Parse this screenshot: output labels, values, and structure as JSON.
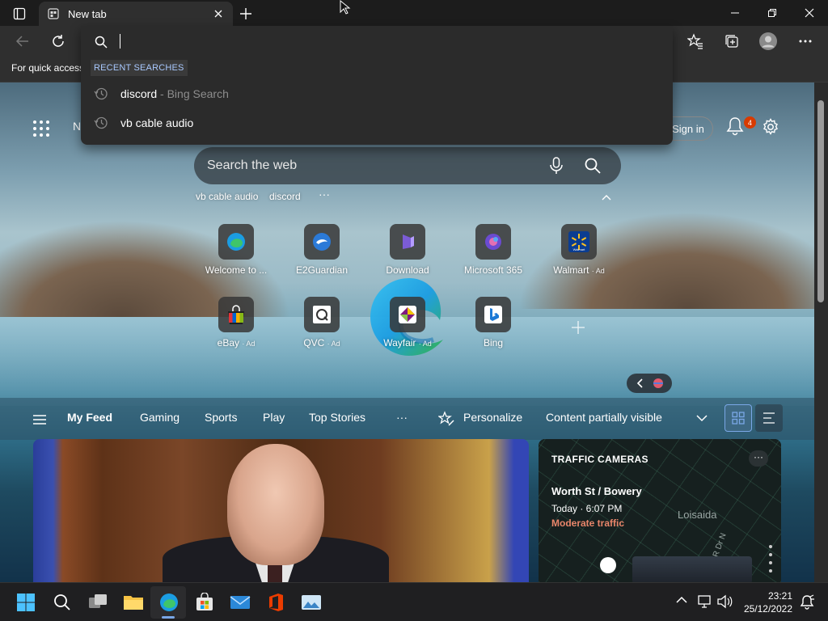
{
  "browser": {
    "tab_title": "New tab",
    "favorites_bar_text": "For quick access"
  },
  "omnibox": {
    "heading": "RECENT SEARCHES",
    "suggestions": [
      {
        "query": "discord",
        "suffix": " - Bing Search"
      },
      {
        "query": "vb cable audio",
        "suffix": ""
      }
    ]
  },
  "newtab": {
    "partial_header_letter": "N",
    "signin_label": "Sign in",
    "notification_count": "4",
    "search_placeholder": "Search the web",
    "recent_chips": [
      "vb cable audio",
      "discord"
    ],
    "more_chips": "···",
    "tiles": [
      {
        "label": "Welcome to ...",
        "ad": "",
        "icon": "edge-icon"
      },
      {
        "label": "E2Guardian",
        "ad": "",
        "icon": "e2guardian-icon"
      },
      {
        "label": "Download",
        "ad": "",
        "icon": "download-icon"
      },
      {
        "label": "Microsoft 365",
        "ad": "",
        "icon": "microsoft-365-icon"
      },
      {
        "label": "Walmart",
        "ad": "· Ad",
        "icon": "walmart-icon"
      },
      {
        "label": "eBay",
        "ad": "· Ad",
        "icon": "ebay-icon"
      },
      {
        "label": "QVC",
        "ad": "· Ad",
        "icon": "qvc-icon"
      },
      {
        "label": "Wayfair",
        "ad": "· Ad",
        "icon": "wayfair-icon"
      },
      {
        "label": "Bing",
        "ad": "",
        "icon": "bing-icon"
      }
    ],
    "walmart_logo_text": "Walmart"
  },
  "feed": {
    "tabs": [
      "My Feed",
      "Gaming",
      "Sports",
      "Play",
      "Top Stories"
    ],
    "more": "···",
    "personalize": "Personalize",
    "visibility": "Content partially visible"
  },
  "traffic": {
    "title": "TRAFFIC CAMERAS",
    "more": "···",
    "street": "Worth St / Bowery",
    "time": "Today · 6:07 PM",
    "status": "Moderate traffic",
    "area": "Loisaida",
    "road": "FDR Dr N"
  },
  "taskbar": {
    "time": "23:21",
    "date": "25/12/2022"
  },
  "colors": {
    "accent": "#7aa7e6",
    "badge": "#d83b01",
    "traffic_status": "#e8856a",
    "omnibox_heading": "#a9c9ff"
  }
}
